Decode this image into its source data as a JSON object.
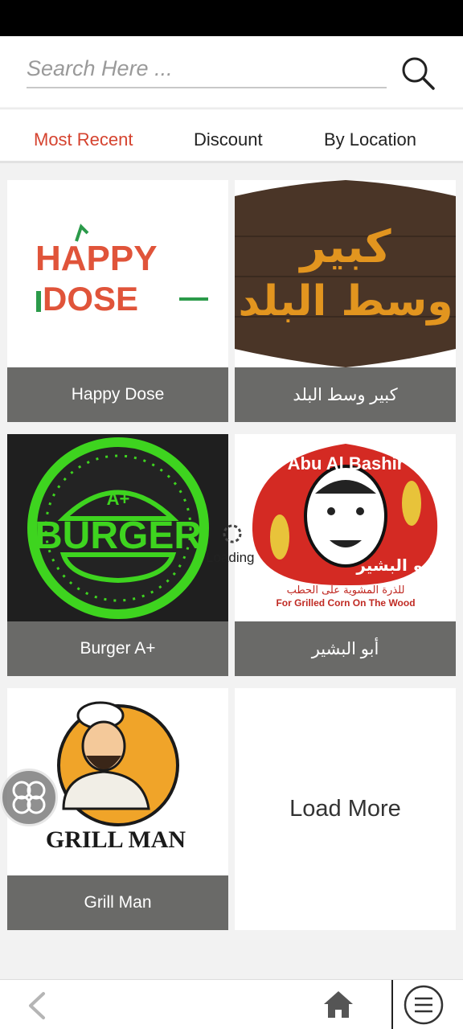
{
  "search": {
    "placeholder": "Search Here ..."
  },
  "tabs": [
    {
      "label": "Most Recent",
      "active": true
    },
    {
      "label": "Discount",
      "active": false
    },
    {
      "label": "By Location",
      "active": false
    }
  ],
  "restaurants": [
    {
      "name": "Happy Dose",
      "logo_text": [
        "HAPPY",
        "DOSE"
      ]
    },
    {
      "name": "كبير وسط البلد",
      "logo_text": [
        "كبير",
        "وسط البلد"
      ]
    },
    {
      "name": "Burger A+",
      "logo_text": [
        "BURGER",
        "A+"
      ]
    },
    {
      "name": "أبو البشير",
      "logo_text": [
        "Abu Al Bashir",
        "أبو البشير",
        "للذرة المشوية على الحطب",
        "For Grilled Corn On The Wood"
      ]
    },
    {
      "name": "Grill Man",
      "logo_text": [
        "GRILL MAN"
      ]
    }
  ],
  "load_more": "Load More",
  "loading_text": "Loading",
  "colors": {
    "accent": "#d5432f",
    "label_bg": "#6a6a68"
  }
}
